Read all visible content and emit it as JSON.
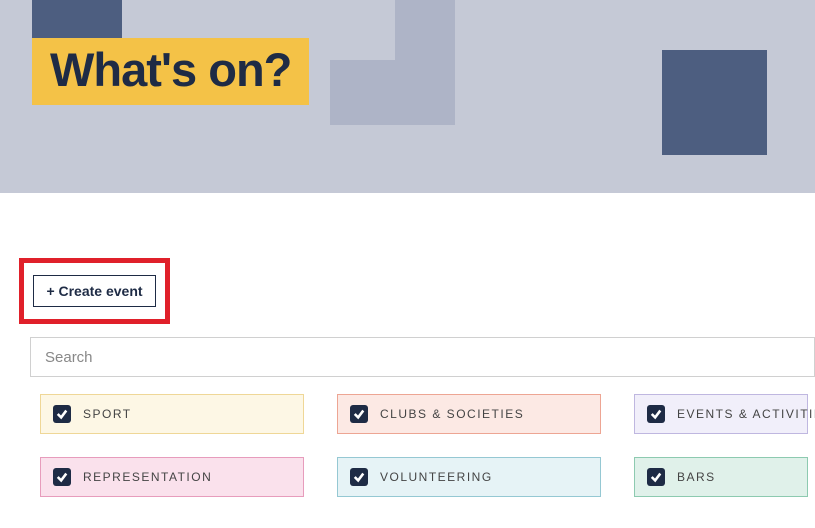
{
  "hero": {
    "title": "What's on?"
  },
  "create_event_label": "+ Create event",
  "search": {
    "placeholder": "Search"
  },
  "filters": [
    {
      "label": "SPORT",
      "checked": true
    },
    {
      "label": "CLUBS & SOCIETIES",
      "checked": true
    },
    {
      "label": "EVENTS & ACTIVITIES",
      "checked": true
    },
    {
      "label": "REPRESENTATION",
      "checked": true
    },
    {
      "label": "VOLUNTEERING",
      "checked": true
    },
    {
      "label": "BARS",
      "checked": true
    }
  ]
}
